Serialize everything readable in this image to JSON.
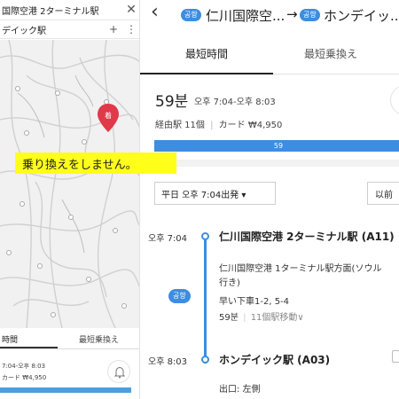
{
  "left_panel": {
    "origin_field": "国際空港 2ターミナル駅",
    "destination_field": "デイック駅",
    "add_label": "+",
    "map_marker_label": "着",
    "tabs": {
      "fastest": "時間",
      "fewest_transfers": "最短乗換え"
    },
    "summary": {
      "time_range": "7:04-오후 8:03",
      "fare": "カード ₩4,950"
    }
  },
  "notice": "乗り換えをしません。",
  "right_panel": {
    "header": {
      "origin_badge": "공항",
      "origin": "仁川国際空...",
      "arrow": "→",
      "destination_badge": "공항",
      "destination": "ホンデイッ..."
    },
    "tabs": {
      "fastest": "最短時間",
      "fewest_transfers": "最短乗換え"
    },
    "summary": {
      "duration": "59분",
      "time_range": "오후 7:04-오후 8:03",
      "stations": "経由駅 11個",
      "separator": "|",
      "fare": "カード ₩4,950",
      "bar_label": "59"
    },
    "departure_select": "平日 오후 7:04出発 ▾",
    "prev_button": "以前",
    "segments": {
      "dep_time": "오후 7:04",
      "dep_station": "仁川国際空港 2ターミナル駅 (A11)",
      "direction_line1": "仁川国際空港 1ターミナル駅方面(ソウル",
      "direction_line2": "行き)",
      "door": "早い下車1-2, 5-4",
      "ride_minutes": "59분",
      "ride_stops": "11個駅移動∨",
      "line_badge": "공항",
      "arr_time": "오후 8:03",
      "arr_station": "ホンデイック駅 (A03)",
      "exit": "出口: 左側"
    }
  },
  "colors": {
    "accent": "#3d8de0",
    "notice_bg": "#ffff19",
    "marker": "#e0394a"
  }
}
